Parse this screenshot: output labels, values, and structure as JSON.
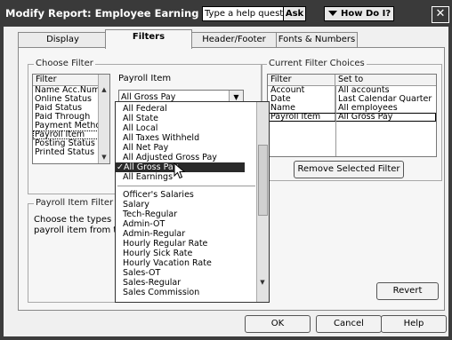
{
  "window": {
    "title": "Modify Report: Employee Earnings Summary",
    "help_placeholder": "Type a help question",
    "ask_label": "Ask",
    "how_do_i_label": "How Do I?",
    "close_glyph": "✕"
  },
  "tabs": [
    {
      "label": "Display"
    },
    {
      "label": "Filters"
    },
    {
      "label": "Header/Footer"
    },
    {
      "label": "Fonts & Numbers"
    }
  ],
  "choose_filter": {
    "group_label": "Choose Filter",
    "list_header": "Filter",
    "items": [
      "Name Acc.Num...",
      "Online Status",
      "Paid Status",
      "Paid Through",
      "Payment Method",
      "Payroll Item",
      "Posting Status",
      "Printed Status"
    ],
    "selected_index": 5,
    "payroll_item_label": "Payroll Item",
    "payroll_item_value": "All Gross Pay"
  },
  "dropdown": {
    "items_top": [
      "All Federal",
      "All State",
      "All Local",
      "All Taxes Withheld",
      "All Net Pay",
      "All Adjusted Gross Pay",
      "All Gross Pay",
      "All Earnings"
    ],
    "highlighted_index": 6,
    "check_mark": "✓",
    "items_bottom": [
      "Officer's Salaries",
      "Salary",
      "Tech-Regular",
      "Admin-OT",
      "Admin-Regular",
      "Hourly Regular Rate",
      "Hourly Sick Rate",
      "Hourly Vacation Rate",
      "Sales-OT",
      "Sales-Regular",
      "Sales Commission"
    ]
  },
  "payroll_item_filter": {
    "group_label": "Payroll Item Filter",
    "description": "Choose the types of payroll items or a specific payroll item from the drop-down list."
  },
  "current_filters": {
    "group_label": "Current Filter Choices",
    "col_filter": "Filter",
    "col_set_to": "Set to",
    "rows": [
      {
        "filter": "Account",
        "set_to": "All accounts"
      },
      {
        "filter": "Date",
        "set_to": "Last Calendar Quarter"
      },
      {
        "filter": "Name",
        "set_to": "All employees"
      },
      {
        "filter": "Payroll Item",
        "set_to": "All Gross Pay"
      }
    ],
    "selected_row": 3,
    "remove_button": "Remove Selected Filter",
    "revert_button": "Revert"
  },
  "footer": {
    "ok": "OK",
    "cancel": "Cancel",
    "help": "Help"
  }
}
